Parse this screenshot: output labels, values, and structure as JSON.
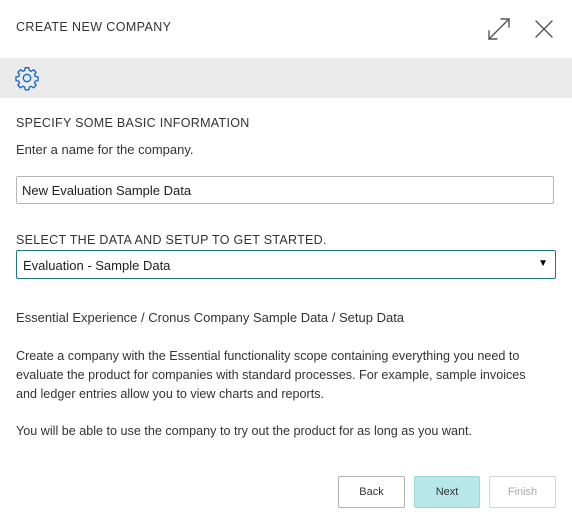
{
  "dialog": {
    "title": "CREATE NEW COMPANY",
    "icons": {
      "expand": "expand-icon",
      "close": "close-icon",
      "settings": "gear-icon"
    }
  },
  "basic_info": {
    "heading": "SPECIFY SOME BASIC INFORMATION",
    "prompt": "Enter a name for the company.",
    "company_name_value": "New Evaluation Sample Data"
  },
  "data_setup": {
    "heading": "SELECT THE DATA AND SETUP TO GET STARTED.",
    "selected_option": "Evaluation - Sample Data",
    "subtitle": "Essential Experience / Cronus Company Sample Data / Setup Data",
    "description": "Create a company with the Essential functionality scope containing everything you need to evaluate the product for companies with standard processes. For example, sample invoices and ledger entries allow you to view charts and reports.",
    "note": "You will be able to use the company to try out the product for as long as you want."
  },
  "buttons": {
    "back": "Back",
    "next": "Next",
    "finish": "Finish"
  },
  "colors": {
    "toolbar_bg": "#eaeaea",
    "accent": "#1f7a7a",
    "gear_icon": "#1565c0",
    "next_button_bg": "#b8e7e9"
  }
}
